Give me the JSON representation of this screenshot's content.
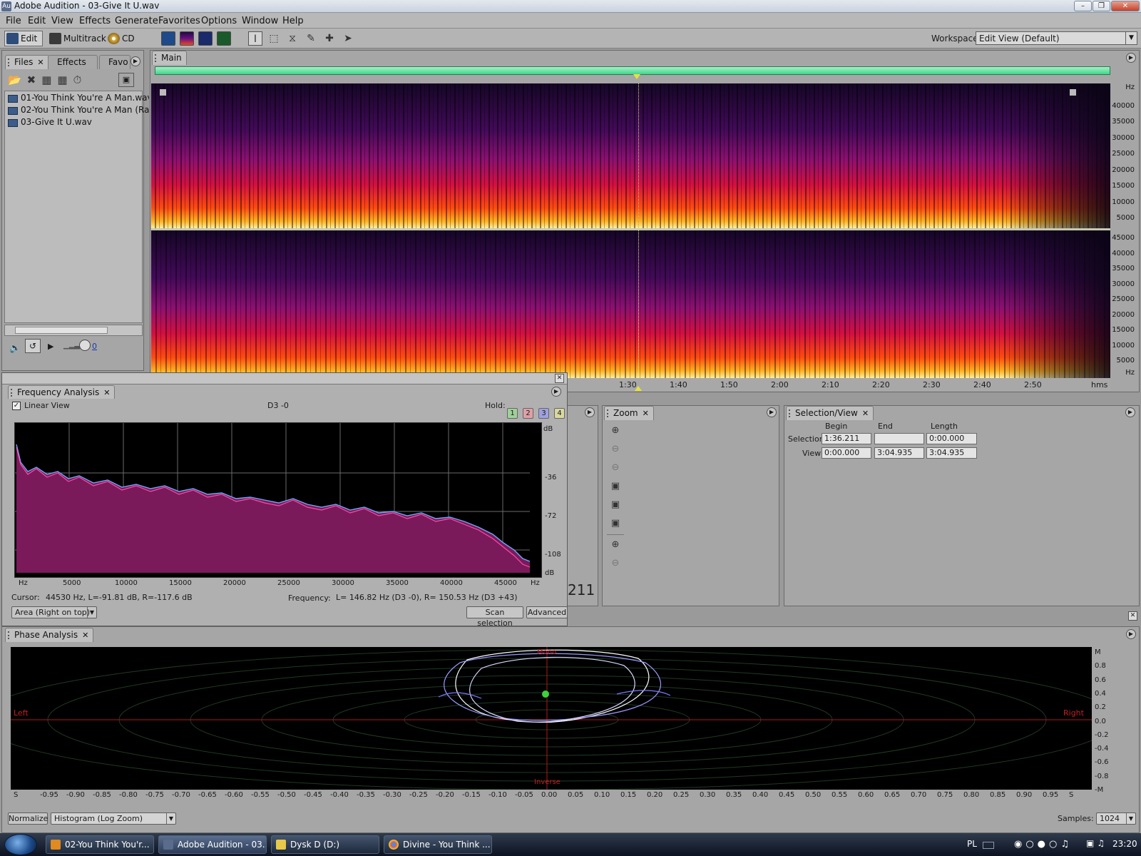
{
  "window": {
    "title": "Adobe Audition - 03-Give It U.wav",
    "app_icon": "Au"
  },
  "menu": [
    "File",
    "Edit",
    "View",
    "Effects",
    "Generate",
    "Favorites",
    "Options",
    "Window",
    "Help"
  ],
  "toolbar": {
    "edit": "Edit",
    "multitrack": "Multitrack",
    "cd": "CD",
    "workspace_label": "Workspace:",
    "workspace_value": "Edit View (Default)"
  },
  "files_panel": {
    "tabs": [
      "Files",
      "Effects",
      "Favo"
    ],
    "files": [
      "01-You Think You're A Man.wav",
      "02-You Think You're A Man (Rad",
      "03-Give It U.wav"
    ],
    "volume_value": "0"
  },
  "editor": {
    "tab": "Main",
    "hz_top": [
      "Hz",
      "40000",
      "35000",
      "30000",
      "25000",
      "20000",
      "15000",
      "10000",
      "5000"
    ],
    "hz_bottom": [
      "45000",
      "40000",
      "35000",
      "30000",
      "25000",
      "20000",
      "15000",
      "10000",
      "5000",
      "Hz"
    ],
    "time_labels": [
      "1:30",
      "1:40",
      "1:50",
      "2:00",
      "2:10",
      "2:20",
      "2:30",
      "2:40",
      "2:50",
      "hms"
    ]
  },
  "freq_analysis": {
    "tab": "Frequency Analysis",
    "linear_view": "Linear View",
    "note": "D3 -0",
    "hold_label": "Hold:",
    "holds": [
      "1",
      "2",
      "3",
      "4"
    ],
    "db_labels": [
      "dB",
      "-36",
      "-72",
      "-108",
      "dB"
    ],
    "x_labels": [
      "Hz",
      "5000",
      "10000",
      "15000",
      "20000",
      "25000",
      "30000",
      "35000",
      "40000",
      "45000",
      "Hz"
    ],
    "cursor_label": "Cursor:",
    "cursor_value": "44530 Hz, L=-91.81 dB, R=-117.6 dB",
    "frequency_label": "Frequency:",
    "frequency_value": "L= 146.82 Hz (D3 -0), R= 150.53 Hz (D3 +43)",
    "mode": "Area (Right on top)",
    "scan": "Scan selection",
    "advanced": "Advanced"
  },
  "big_time_fragment": "211",
  "zoom_panel": {
    "tab": "Zoom"
  },
  "selection_panel": {
    "tab": "Selection/View",
    "cols": [
      "Begin",
      "End",
      "Length"
    ],
    "selection_label": "Selection",
    "view_label": "View",
    "selection": [
      "1:36.211",
      "",
      "0:00.000"
    ],
    "view": [
      "0:00.000",
      "3:04.935",
      "3:04.935"
    ]
  },
  "phase_panel": {
    "tab": "Phase Analysis",
    "left": "Left",
    "right": "Right",
    "mono": "Mono",
    "inverse": "Inverse",
    "y_labels": [
      "M",
      "0.8",
      "0.6",
      "0.4",
      "0.2",
      "0.0",
      "-0.2",
      "-0.4",
      "-0.6",
      "-0.8",
      "-M"
    ],
    "x_labels": [
      "S",
      "-0.95",
      "-0.90",
      "-0.85",
      "-0.80",
      "-0.75",
      "-0.70",
      "-0.65",
      "-0.60",
      "-0.55",
      "-0.50",
      "-0.45",
      "-0.40",
      "-0.35",
      "-0.30",
      "-0.25",
      "-0.20",
      "-0.15",
      "-0.10",
      "-0.05",
      "0.00",
      "0.05",
      "0.10",
      "0.15",
      "0.20",
      "0.25",
      "0.30",
      "0.35",
      "0.40",
      "0.45",
      "0.50",
      "0.55",
      "0.60",
      "0.65",
      "0.70",
      "0.75",
      "0.80",
      "0.85",
      "0.90",
      "0.95",
      "S"
    ],
    "normalize": "Normalize",
    "display_mode": "Histogram (Log Zoom)",
    "samples_label": "Samples:",
    "samples_value": "1024"
  },
  "taskbar": {
    "items": [
      "02-You Think You'r...",
      "Adobe Audition - 03...",
      "Dysk D (D:)",
      "Divine - You Think ..."
    ],
    "lang": "PL",
    "clock": "23:20"
  },
  "colors": {
    "spectrum_fill": "#7a1a5a",
    "spectrum_line_l": "#ff4aa8",
    "spectrum_line_r": "#6aa8ff",
    "overview": "#3fd68a",
    "phase_line": "#d8d8ff"
  }
}
